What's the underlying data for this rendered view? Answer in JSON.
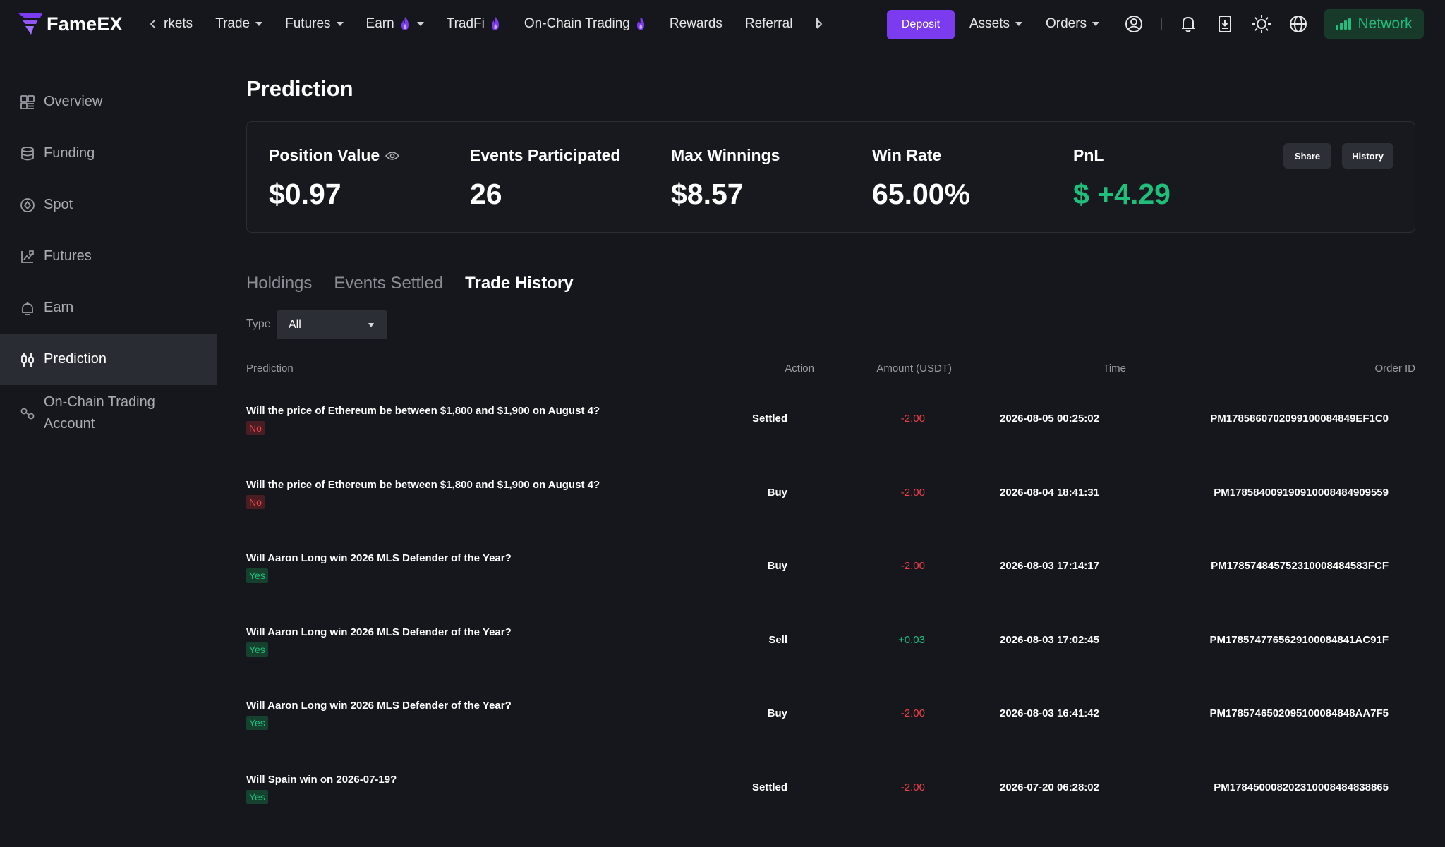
{
  "nav": {
    "brand": "FameEX",
    "items": [
      {
        "label": "rkets",
        "caret": false,
        "fire": false
      },
      {
        "label": "Trade",
        "caret": true,
        "fire": false
      },
      {
        "label": "Futures",
        "caret": true,
        "fire": false
      },
      {
        "label": "Earn",
        "caret": true,
        "fire": true
      },
      {
        "label": "TradFi",
        "caret": false,
        "fire": true
      },
      {
        "label": "On-Chain Trading",
        "caret": false,
        "fire": true
      },
      {
        "label": "Rewards",
        "caret": false,
        "fire": false
      },
      {
        "label": "Referral",
        "caret": false,
        "fire": false
      },
      {
        "label": "I",
        "caret": false,
        "fire": false
      }
    ],
    "deposit": "Deposit",
    "assets": "Assets",
    "orders": "Orders",
    "network": "Network",
    "icons": [
      "user-circle-icon",
      "bell-icon",
      "download-app-icon",
      "sun-icon",
      "globe-icon"
    ],
    "accent": "#7b3cf0",
    "network_color": "#1fbe7a"
  },
  "sidebar": {
    "items": [
      {
        "label": "Overview",
        "icon": "overview-icon",
        "active": false
      },
      {
        "label": "Funding",
        "icon": "funding-icon",
        "active": false
      },
      {
        "label": "Spot",
        "icon": "spot-icon",
        "active": false
      },
      {
        "label": "Futures",
        "icon": "futures-icon",
        "active": false
      },
      {
        "label": "Earn",
        "icon": "earn-icon",
        "active": false
      },
      {
        "label": "Prediction",
        "icon": "prediction-icon",
        "active": true
      },
      {
        "label": "On-Chain Trading Account",
        "icon": "on-chain-icon",
        "active": false
      }
    ]
  },
  "page": {
    "title": "Prediction"
  },
  "stats": {
    "position_value": {
      "label": "Position Value",
      "value": "$0.97"
    },
    "events_participated": {
      "label": "Events Participated",
      "value": "26"
    },
    "max_winnings": {
      "label": "Max Winnings",
      "value": "$8.57"
    },
    "win_rate": {
      "label": "Win Rate",
      "value": "65.00%"
    },
    "pnl": {
      "label": "PnL",
      "value": "$ +4.29"
    },
    "share": "Share",
    "history": "History"
  },
  "tabs": [
    {
      "label": "Holdings",
      "active": false
    },
    {
      "label": "Events Settled",
      "active": false
    },
    {
      "label": "Trade History",
      "active": true
    }
  ],
  "filter": {
    "label": "Type",
    "value": "All"
  },
  "table": {
    "headers": {
      "prediction": "Prediction",
      "action": "Action",
      "amount": "Amount (USDT)",
      "time": "Time",
      "order_id": "Order ID"
    },
    "rows": [
      {
        "question": "Will the price of Ethereum be between $1,800 and $1,900 on August 4?",
        "outcome": "No",
        "action": "Settled",
        "amount": "-2.00",
        "time": "2026-08-05 00:25:02",
        "order_id": "PM1785860702099100084849EF1C0"
      },
      {
        "question": "Will the price of Ethereum be between $1,800 and $1,900 on August 4?",
        "outcome": "No",
        "action": "Buy",
        "amount": "-2.00",
        "time": "2026-08-04 18:41:31",
        "order_id": "PM1785840091909100084849095​59"
      },
      {
        "question": "Will Aaron Long win 2026 MLS Defender of the Year?",
        "outcome": "Yes",
        "action": "Buy",
        "amount": "-2.00",
        "time": "2026-08-03 17:14:17",
        "order_id": "PM1785748457523100084845​83FCF"
      },
      {
        "question": "Will Aaron Long win 2026 MLS Defender of the Year?",
        "outcome": "Yes",
        "action": "Sell",
        "amount": "+0.03",
        "time": "2026-08-03 17:02:45",
        "order_id": "PM178574776562910008484​1AC91F"
      },
      {
        "question": "Will Aaron Long win 2026 MLS Defender of the Year?",
        "outcome": "Yes",
        "action": "Buy",
        "amount": "-2.00",
        "time": "2026-08-03 16:41:42",
        "order_id": "PM178574650209510008484​8AA7F5"
      },
      {
        "question": "Will Spain win on 2026-07-19?",
        "outcome": "Yes",
        "action": "Settled",
        "amount": "-2.00",
        "time": "2026-07-20 06:28:02",
        "order_id": "PM1784500082023100084848​38865"
      }
    ]
  }
}
